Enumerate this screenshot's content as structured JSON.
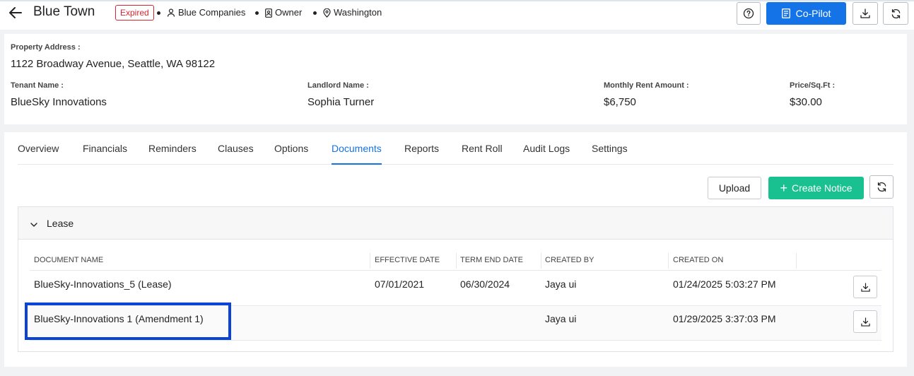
{
  "header": {
    "title": "Blue Town",
    "status": "Expired",
    "company": "Blue Companies",
    "role": "Owner",
    "location": "Washington",
    "copilot_label": "Co-Pilot"
  },
  "property": {
    "address_label": "Property Address :",
    "address_value": "1122 Broadway Avenue, Seattle, WA 98122",
    "tenant_label": "Tenant Name :",
    "tenant_value": "BlueSky Innovations",
    "landlord_label": "Landlord Name :",
    "landlord_value": "Sophia Turner",
    "rent_label": "Monthly Rent Amount :",
    "rent_value": "$6,750",
    "price_label": "Price/Sq.Ft :",
    "price_value": "$30.00"
  },
  "tabs": [
    "Overview",
    "Financials",
    "Reminders",
    "Clauses",
    "Options",
    "Documents",
    "Reports",
    "Rent Roll",
    "Audit Logs",
    "Settings"
  ],
  "active_tab": "Documents",
  "actions": {
    "upload": "Upload",
    "create_notice": "Create Notice"
  },
  "section": {
    "title": "Lease"
  },
  "table": {
    "headers": [
      "DOCUMENT NAME",
      "EFFECTIVE DATE",
      "TERM END DATE",
      "CREATED BY",
      "CREATED ON"
    ],
    "rows": [
      {
        "name": "BlueSky-Innovations_5 (Lease)",
        "effective": "07/01/2021",
        "term_end": "06/30/2024",
        "created_by": "Jaya ui",
        "created_on": "01/24/2025 5:03:27 PM"
      },
      {
        "name": "BlueSky-Innovations 1 (Amendment 1)",
        "effective": "",
        "term_end": "",
        "created_by": "Jaya ui",
        "created_on": "01/29/2025 3:37:03 PM"
      }
    ]
  },
  "colors": {
    "primary": "#1473e6",
    "success": "#19c191",
    "danger": "#d9262c",
    "highlight": "#0a43d6"
  }
}
